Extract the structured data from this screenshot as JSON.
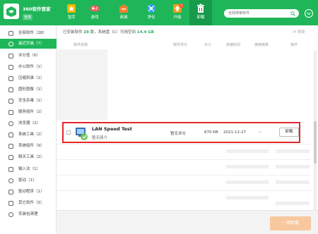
{
  "header": {
    "brand_name": "360软件管家",
    "login_label": "登录",
    "tabs": [
      {
        "label": "宝库",
        "icon": "star-icon"
      },
      {
        "label": "游戏",
        "icon": "gamepad-icon"
      },
      {
        "label": "商城",
        "icon": "shop-icon"
      },
      {
        "label": "净化",
        "icon": "purify-icon"
      },
      {
        "label": "升级",
        "icon": "upgrade-icon",
        "badge": "5"
      },
      {
        "label": "卸载",
        "icon": "trash-icon",
        "active": true
      }
    ],
    "search_placeholder": "全网搜索软件",
    "colors": {
      "header_bg": "#1fb65a",
      "active_tab": "#179a4b"
    }
  },
  "sidebar": {
    "items": [
      {
        "label": "全部软件（28）",
        "icon": "grid-icon"
      },
      {
        "label": "最近安装（7）",
        "icon": "clock-icon",
        "active": true
      },
      {
        "label": "评分低（6）",
        "icon": "thumb-down-icon"
      },
      {
        "label": "办公软件（1）",
        "icon": "office-icon"
      },
      {
        "label": "压缩刻录（1）",
        "icon": "compress-icon"
      },
      {
        "label": "图形图像（1）",
        "icon": "image-icon"
      },
      {
        "label": "安全杀毒（1）",
        "icon": "shield-icon"
      },
      {
        "label": "服务组件（2）",
        "icon": "component-icon"
      },
      {
        "label": "浏览器（2）",
        "icon": "browser-icon"
      },
      {
        "label": "系统工具（2）",
        "icon": "tools-icon"
      },
      {
        "label": "系统组件（9）",
        "icon": "system-icon"
      },
      {
        "label": "聊天工具（2）",
        "icon": "chat-icon"
      },
      {
        "label": "输入法（1）",
        "icon": "keyboard-icon"
      },
      {
        "label": "驱动（1）",
        "icon": "driver-icon"
      },
      {
        "label": "驱动程序（1）",
        "icon": "driver-program-icon"
      },
      {
        "label": "其它软件（5）",
        "icon": "other-icon"
      },
      {
        "label": "安装包清理",
        "icon": "clean-icon"
      }
    ]
  },
  "main": {
    "stat_prefix": "已安装软件",
    "stat_count": "28",
    "stat_mid": "款，系统盘（C）可用空间",
    "stat_space": "14.4 GB",
    "refresh_label": "刷新",
    "columns": [
      "软件名称",
      "软件评分",
      "大小",
      "安装时间",
      "使用频率",
      "操作"
    ],
    "highlight_row": {
      "name": "LAN Speed Test",
      "subtitle": "暂无简介",
      "rating": "暂无评分",
      "size": "870 KB",
      "date": "2021-12-27",
      "frequency": "--",
      "action": "卸载",
      "icon": "lan-speed-test-icon"
    },
    "footer_button": "一键卸载"
  }
}
